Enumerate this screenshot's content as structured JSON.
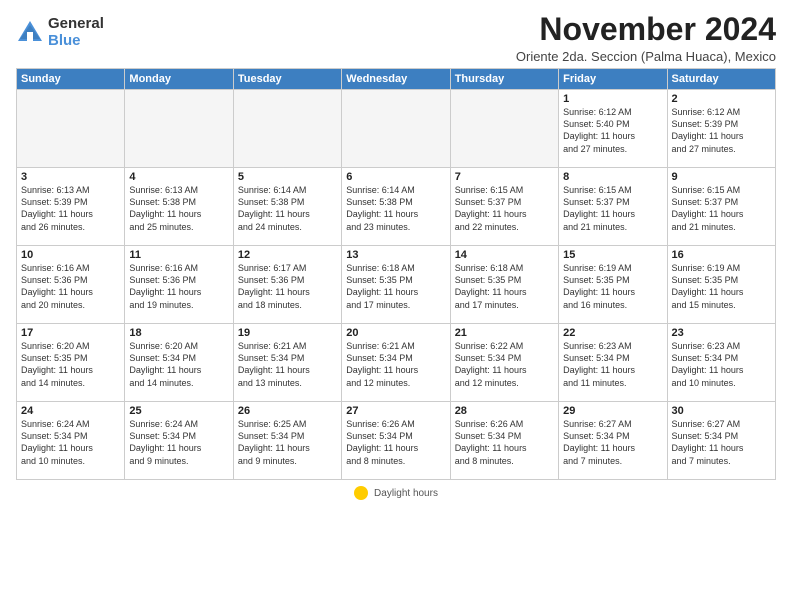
{
  "header": {
    "logo_general": "General",
    "logo_blue": "Blue",
    "month_title": "November 2024",
    "subtitle": "Oriente 2da. Seccion (Palma Huaca), Mexico"
  },
  "weekdays": [
    "Sunday",
    "Monday",
    "Tuesday",
    "Wednesday",
    "Thursday",
    "Friday",
    "Saturday"
  ],
  "legend_label": "Daylight hours",
  "weeks": [
    [
      {
        "day": "",
        "info": ""
      },
      {
        "day": "",
        "info": ""
      },
      {
        "day": "",
        "info": ""
      },
      {
        "day": "",
        "info": ""
      },
      {
        "day": "",
        "info": ""
      },
      {
        "day": "1",
        "info": "Sunrise: 6:12 AM\nSunset: 5:40 PM\nDaylight: 11 hours\nand 27 minutes."
      },
      {
        "day": "2",
        "info": "Sunrise: 6:12 AM\nSunset: 5:39 PM\nDaylight: 11 hours\nand 27 minutes."
      }
    ],
    [
      {
        "day": "3",
        "info": "Sunrise: 6:13 AM\nSunset: 5:39 PM\nDaylight: 11 hours\nand 26 minutes."
      },
      {
        "day": "4",
        "info": "Sunrise: 6:13 AM\nSunset: 5:38 PM\nDaylight: 11 hours\nand 25 minutes."
      },
      {
        "day": "5",
        "info": "Sunrise: 6:14 AM\nSunset: 5:38 PM\nDaylight: 11 hours\nand 24 minutes."
      },
      {
        "day": "6",
        "info": "Sunrise: 6:14 AM\nSunset: 5:38 PM\nDaylight: 11 hours\nand 23 minutes."
      },
      {
        "day": "7",
        "info": "Sunrise: 6:15 AM\nSunset: 5:37 PM\nDaylight: 11 hours\nand 22 minutes."
      },
      {
        "day": "8",
        "info": "Sunrise: 6:15 AM\nSunset: 5:37 PM\nDaylight: 11 hours\nand 21 minutes."
      },
      {
        "day": "9",
        "info": "Sunrise: 6:15 AM\nSunset: 5:37 PM\nDaylight: 11 hours\nand 21 minutes."
      }
    ],
    [
      {
        "day": "10",
        "info": "Sunrise: 6:16 AM\nSunset: 5:36 PM\nDaylight: 11 hours\nand 20 minutes."
      },
      {
        "day": "11",
        "info": "Sunrise: 6:16 AM\nSunset: 5:36 PM\nDaylight: 11 hours\nand 19 minutes."
      },
      {
        "day": "12",
        "info": "Sunrise: 6:17 AM\nSunset: 5:36 PM\nDaylight: 11 hours\nand 18 minutes."
      },
      {
        "day": "13",
        "info": "Sunrise: 6:18 AM\nSunset: 5:35 PM\nDaylight: 11 hours\nand 17 minutes."
      },
      {
        "day": "14",
        "info": "Sunrise: 6:18 AM\nSunset: 5:35 PM\nDaylight: 11 hours\nand 17 minutes."
      },
      {
        "day": "15",
        "info": "Sunrise: 6:19 AM\nSunset: 5:35 PM\nDaylight: 11 hours\nand 16 minutes."
      },
      {
        "day": "16",
        "info": "Sunrise: 6:19 AM\nSunset: 5:35 PM\nDaylight: 11 hours\nand 15 minutes."
      }
    ],
    [
      {
        "day": "17",
        "info": "Sunrise: 6:20 AM\nSunset: 5:35 PM\nDaylight: 11 hours\nand 14 minutes."
      },
      {
        "day": "18",
        "info": "Sunrise: 6:20 AM\nSunset: 5:34 PM\nDaylight: 11 hours\nand 14 minutes."
      },
      {
        "day": "19",
        "info": "Sunrise: 6:21 AM\nSunset: 5:34 PM\nDaylight: 11 hours\nand 13 minutes."
      },
      {
        "day": "20",
        "info": "Sunrise: 6:21 AM\nSunset: 5:34 PM\nDaylight: 11 hours\nand 12 minutes."
      },
      {
        "day": "21",
        "info": "Sunrise: 6:22 AM\nSunset: 5:34 PM\nDaylight: 11 hours\nand 12 minutes."
      },
      {
        "day": "22",
        "info": "Sunrise: 6:23 AM\nSunset: 5:34 PM\nDaylight: 11 hours\nand 11 minutes."
      },
      {
        "day": "23",
        "info": "Sunrise: 6:23 AM\nSunset: 5:34 PM\nDaylight: 11 hours\nand 10 minutes."
      }
    ],
    [
      {
        "day": "24",
        "info": "Sunrise: 6:24 AM\nSunset: 5:34 PM\nDaylight: 11 hours\nand 10 minutes."
      },
      {
        "day": "25",
        "info": "Sunrise: 6:24 AM\nSunset: 5:34 PM\nDaylight: 11 hours\nand 9 minutes."
      },
      {
        "day": "26",
        "info": "Sunrise: 6:25 AM\nSunset: 5:34 PM\nDaylight: 11 hours\nand 9 minutes."
      },
      {
        "day": "27",
        "info": "Sunrise: 6:26 AM\nSunset: 5:34 PM\nDaylight: 11 hours\nand 8 minutes."
      },
      {
        "day": "28",
        "info": "Sunrise: 6:26 AM\nSunset: 5:34 PM\nDaylight: 11 hours\nand 8 minutes."
      },
      {
        "day": "29",
        "info": "Sunrise: 6:27 AM\nSunset: 5:34 PM\nDaylight: 11 hours\nand 7 minutes."
      },
      {
        "day": "30",
        "info": "Sunrise: 6:27 AM\nSunset: 5:34 PM\nDaylight: 11 hours\nand 7 minutes."
      }
    ]
  ]
}
